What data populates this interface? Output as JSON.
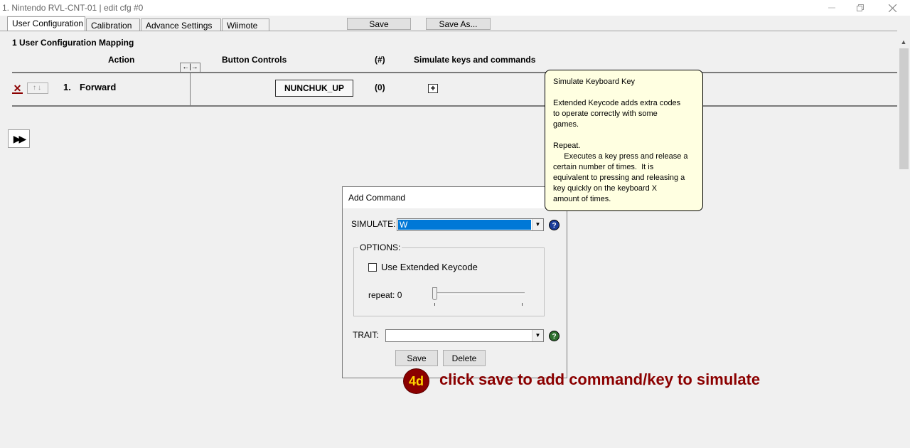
{
  "window": {
    "title": "1. Nintendo RVL-CNT-01 | edit cfg #0"
  },
  "tabs": [
    {
      "label": "User Configuration",
      "active": true
    },
    {
      "label": "Calibration",
      "active": false
    },
    {
      "label": "Advance Settings",
      "active": false
    },
    {
      "label": "Wiimote",
      "active": false
    }
  ],
  "toolbar": {
    "save_label": "Save",
    "save_as_label": "Save As..."
  },
  "mapping": {
    "title": "1 User Configuration Mapping",
    "columns": {
      "action": "Action",
      "button_controls": "Button Controls",
      "count": "(#)",
      "simulate": "Simulate keys and commands"
    },
    "rows": [
      {
        "index": "1.",
        "action": "Forward",
        "button": "NUNCHUK_UP",
        "count": "(0)"
      }
    ]
  },
  "dialog": {
    "title": "Add Command",
    "simulate_label": "SIMULATE:",
    "simulate_value": "W",
    "options_label": "OPTIONS:",
    "extended_keycode_label": "Use Extended Keycode",
    "extended_keycode_checked": false,
    "repeat_label": "repeat: 0",
    "repeat_value": 0,
    "trait_label": "TRAIT:",
    "trait_value": "",
    "save_label": "Save",
    "delete_label": "Delete"
  },
  "tooltip": {
    "title": "Simulate Keyboard Key",
    "para1": "Extended Keycode adds extra codes\nto operate correctly with some\ngames.",
    "para2": "Repeat.\n     Executes a key press and release a\ncertain number of times.  It is\nequivalent to pressing and releasing a\nkey quickly on the keyboard X\namount of times."
  },
  "annotation": {
    "step": "4d",
    "text": "click save to add command/key to simulate",
    "color": "#8b0000"
  },
  "icons": {
    "minimize": "minimize-icon",
    "restore": "restore-icon",
    "close": "close-icon",
    "help": "help-icon"
  }
}
